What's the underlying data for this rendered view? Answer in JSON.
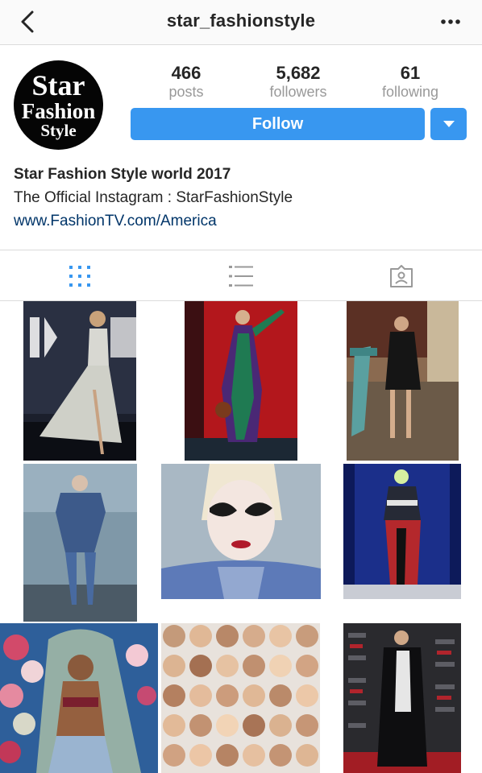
{
  "header": {
    "username": "star_fashionstyle",
    "back_icon": "chevron-left-icon",
    "more_icon": "more-horizontal-icon"
  },
  "profile": {
    "avatar": {
      "line1": "Star",
      "line2": "Fashion",
      "line3": "Style"
    },
    "stats": [
      {
        "value": "466",
        "label": "posts"
      },
      {
        "value": "5,682",
        "label": "followers"
      },
      {
        "value": "61",
        "label": "following"
      }
    ],
    "follow_label": "Follow",
    "dropdown_icon": "caret-down-icon",
    "accent_color": "#3897f0",
    "bio_name": "Star Fashion Style world 2017",
    "bio_text": "The Official Instagram : StarFashionStyle",
    "bio_link": "www.FashionTV.com/America",
    "link_color": "#003569"
  },
  "tabs": [
    {
      "name": "grid-view",
      "icon": "grid-icon",
      "active": true
    },
    {
      "name": "list-view",
      "icon": "list-icon",
      "active": false
    },
    {
      "name": "tagged",
      "icon": "tagged-person-icon",
      "active": false
    }
  ],
  "posts": [
    {
      "subject": "woman in white ruffled gown on dark backdrop"
    },
    {
      "subject": "woman in purple and green outfit on red wall"
    },
    {
      "subject": "woman in black coat beside green slide"
    },
    {
      "subject": "performer in sparkling blue bodysuit"
    },
    {
      "subject": "close-up with jeweled eye makeup"
    },
    {
      "subject": "woman in striped top on blue curtain stage"
    },
    {
      "subject": "woman with veil among flowers"
    },
    {
      "subject": "collage grid of faces"
    },
    {
      "subject": "person in long black coat on red carpet"
    }
  ]
}
